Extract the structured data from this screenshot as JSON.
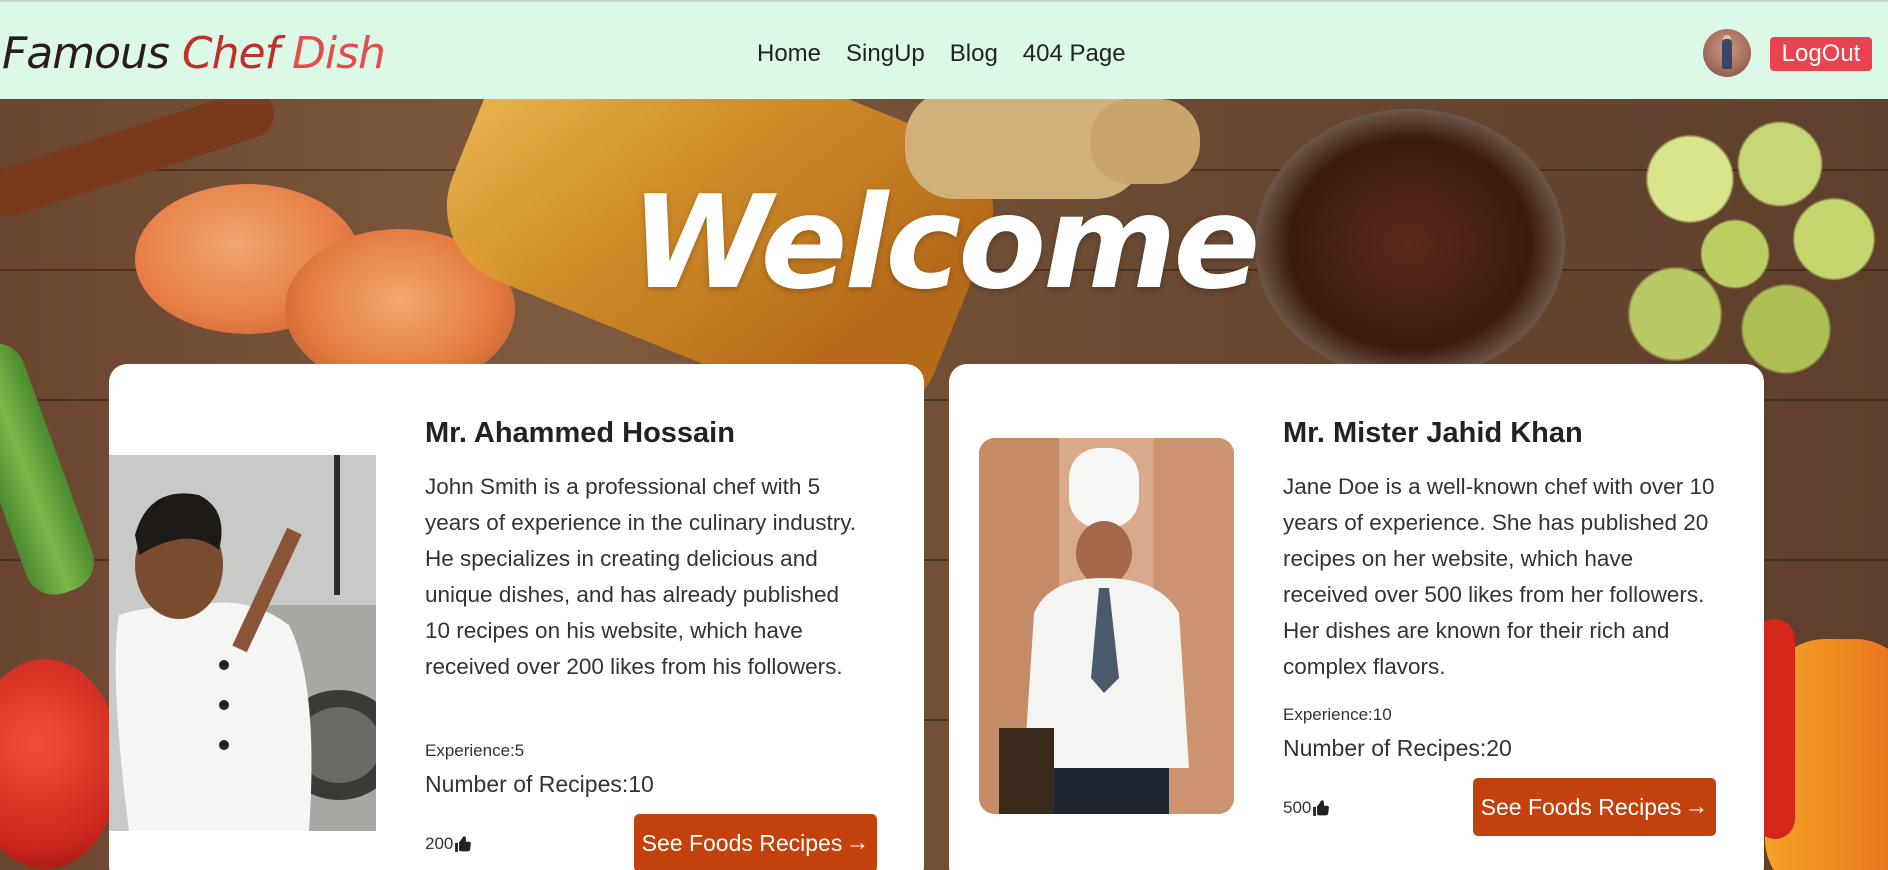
{
  "navbar": {
    "brand": {
      "part1": "Famous ",
      "part2": "Chef ",
      "part3": "Dish"
    },
    "links": [
      "Home",
      "SingUp",
      "Blog",
      "404 Page"
    ],
    "logout_label": "LogOut",
    "colors": {
      "background": "#dcf9e8",
      "logout": "#e8434e",
      "brand_red": "#c0302a"
    }
  },
  "hero": {
    "title": "Welcome"
  },
  "chefs": [
    {
      "name": "Mr. Ahammed Hossain",
      "bio": "John Smith is a professional chef with 5 years of experience in the culinary industry. He specializes in creating delicious and unique dishes, and has already published 10 recipes on his website, which have received over 200 likes from his followers.",
      "experience": "Experience:5",
      "recipes": "Number of Recipes:10",
      "likes": "200",
      "button_label": "See Foods Recipes"
    },
    {
      "name": "Mr. Mister Jahid Khan",
      "bio": "Jane Doe is a well-known chef with over 10 years of experience. She has published 20 recipes on her website, which have received over 500 likes from her followers. Her dishes are known for their rich and complex flavors.",
      "experience": "Experience:10",
      "recipes": "Number of Recipes:20",
      "likes": "500",
      "button_label": "See Foods Recipes"
    }
  ],
  "icons": {
    "like": "thumbs-up-icon",
    "arrow": "arrow-right-icon"
  },
  "accent": "#c2410c"
}
